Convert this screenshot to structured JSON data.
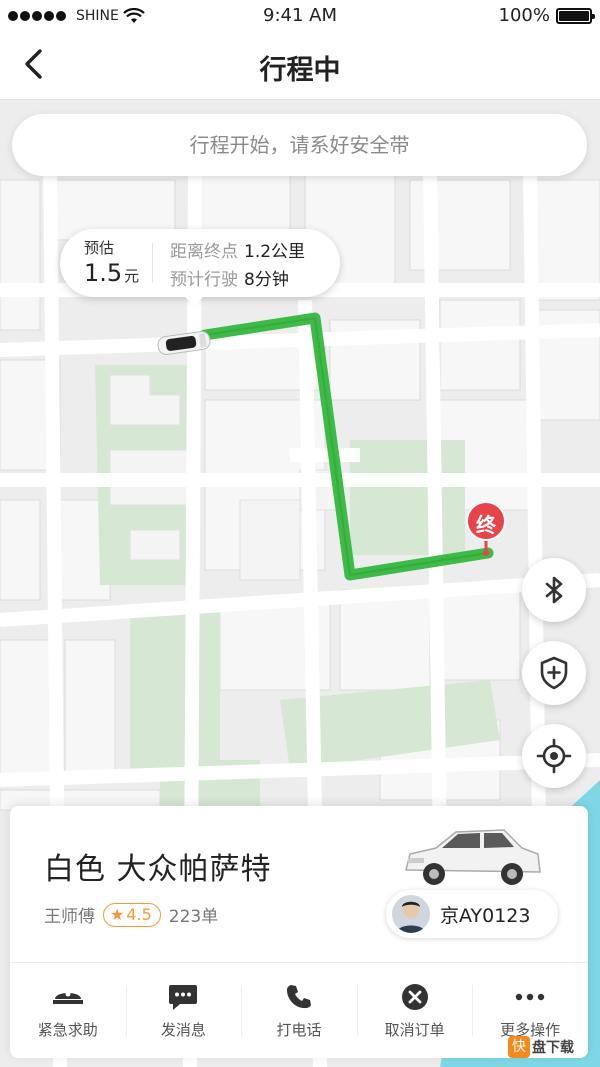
{
  "status_bar": {
    "carrier": "SHINE",
    "time": "9:41 AM",
    "battery": "100%"
  },
  "nav": {
    "title": "行程中"
  },
  "notice": {
    "text": "行程开始，请系好安全带"
  },
  "estimate": {
    "label": "预估",
    "price": "1.5",
    "unit": "元",
    "distance_label": "距离终点",
    "distance_value": "1.2公里",
    "duration_label": "预计行驶",
    "duration_value": "8分钟"
  },
  "map": {
    "destination_marker": "终",
    "route_color": "#3dbb46",
    "marker_color": "#e8424a"
  },
  "fabs": [
    "bluetooth-icon",
    "shield-plus-icon",
    "locate-icon"
  ],
  "car": {
    "title": "白色 大众帕萨特",
    "driver": "王师傅",
    "rating": "4.5",
    "orders": "223单",
    "plate": "京AY0123"
  },
  "actions": [
    {
      "label": "紧急求助",
      "icon": "police-icon"
    },
    {
      "label": "发消息",
      "icon": "message-icon"
    },
    {
      "label": "打电话",
      "icon": "phone-icon"
    },
    {
      "label": "取消订单",
      "icon": "cancel-icon"
    },
    {
      "label": "更多操作",
      "icon": "more-icon"
    }
  ],
  "watermark": {
    "logo": "快",
    "text": "盘下载"
  },
  "accent_color": "#f39a3a"
}
